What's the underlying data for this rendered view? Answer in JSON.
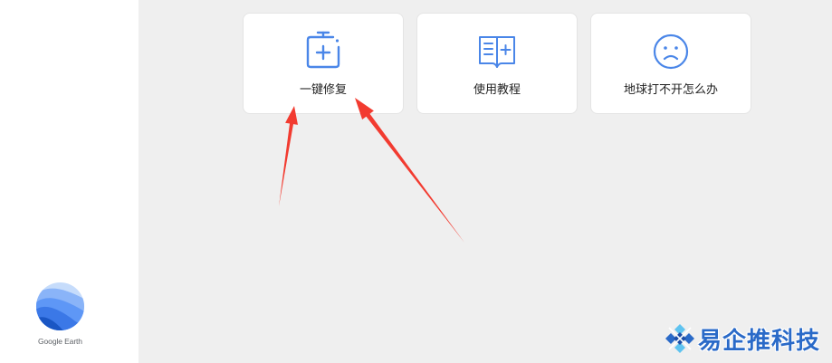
{
  "sidebar": {
    "logo_icon": "google-earth-logo",
    "logo_text": "Google Earth"
  },
  "cards": [
    {
      "label": "一键修复",
      "icon": "repair-kit-icon"
    },
    {
      "label": "使用教程",
      "icon": "book-icon"
    },
    {
      "label": "地球打不开怎么办",
      "icon": "sad-face-icon"
    }
  ],
  "watermark": {
    "text": "易企推科技",
    "icon": "company-logo"
  },
  "colors": {
    "accent": "#4a86e8",
    "sidebar_bg": "#ffffff",
    "main_bg": "#efefef",
    "card_bg": "#ffffff",
    "annotation_arrow": "#f23b30",
    "watermark_text": "#2a6ac8"
  }
}
